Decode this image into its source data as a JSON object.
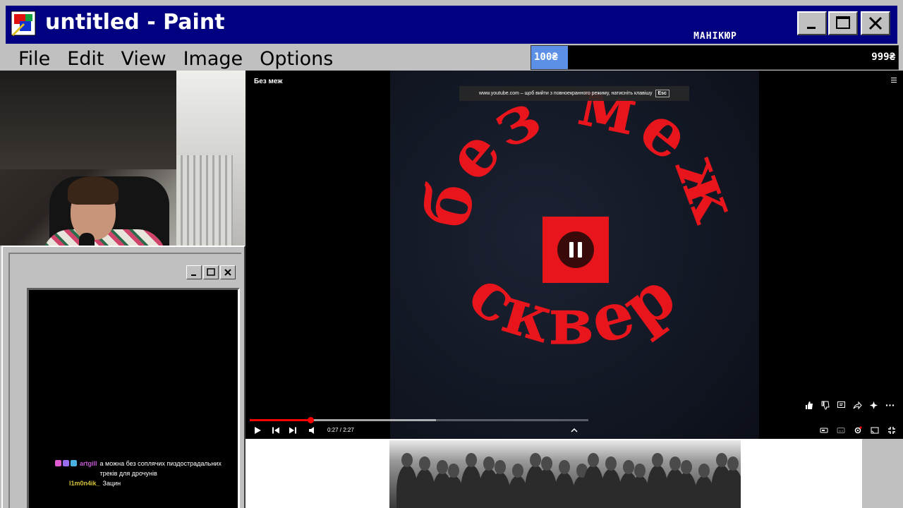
{
  "window": {
    "title": "untitled - Paint",
    "menus": [
      {
        "label": "File"
      },
      {
        "label": "Edit"
      },
      {
        "label": "View"
      },
      {
        "label": "Image"
      },
      {
        "label": "Options"
      }
    ]
  },
  "donation_goal": {
    "label": "МАНІКЮР",
    "current": "100₴",
    "target": "999₴",
    "progress_fraction": 0.1,
    "fill_color": "#5c8fe6"
  },
  "player": {
    "video_title": "Без меж",
    "fullscreen_notice": "www.youtube.com – щоб вийти з повноекранного режиму, натисніть клавішу",
    "esc_label": "Esc",
    "time": "0:27 / 2:27",
    "progress_fraction": 0.18,
    "buffered_fraction": 0.55,
    "accent_color": "#ff0000",
    "artwork_top_text": "без меж",
    "artwork_bottom_text": "сквер"
  },
  "chat": [
    {
      "user": "artgill",
      "user_color": "#c65bd6",
      "message": "а можна без соплячих пиздострадальних треків для дрочунів"
    },
    {
      "user": "l1m0n4ik_",
      "user_color": "#d4c23a",
      "message": "Зацин"
    }
  ]
}
